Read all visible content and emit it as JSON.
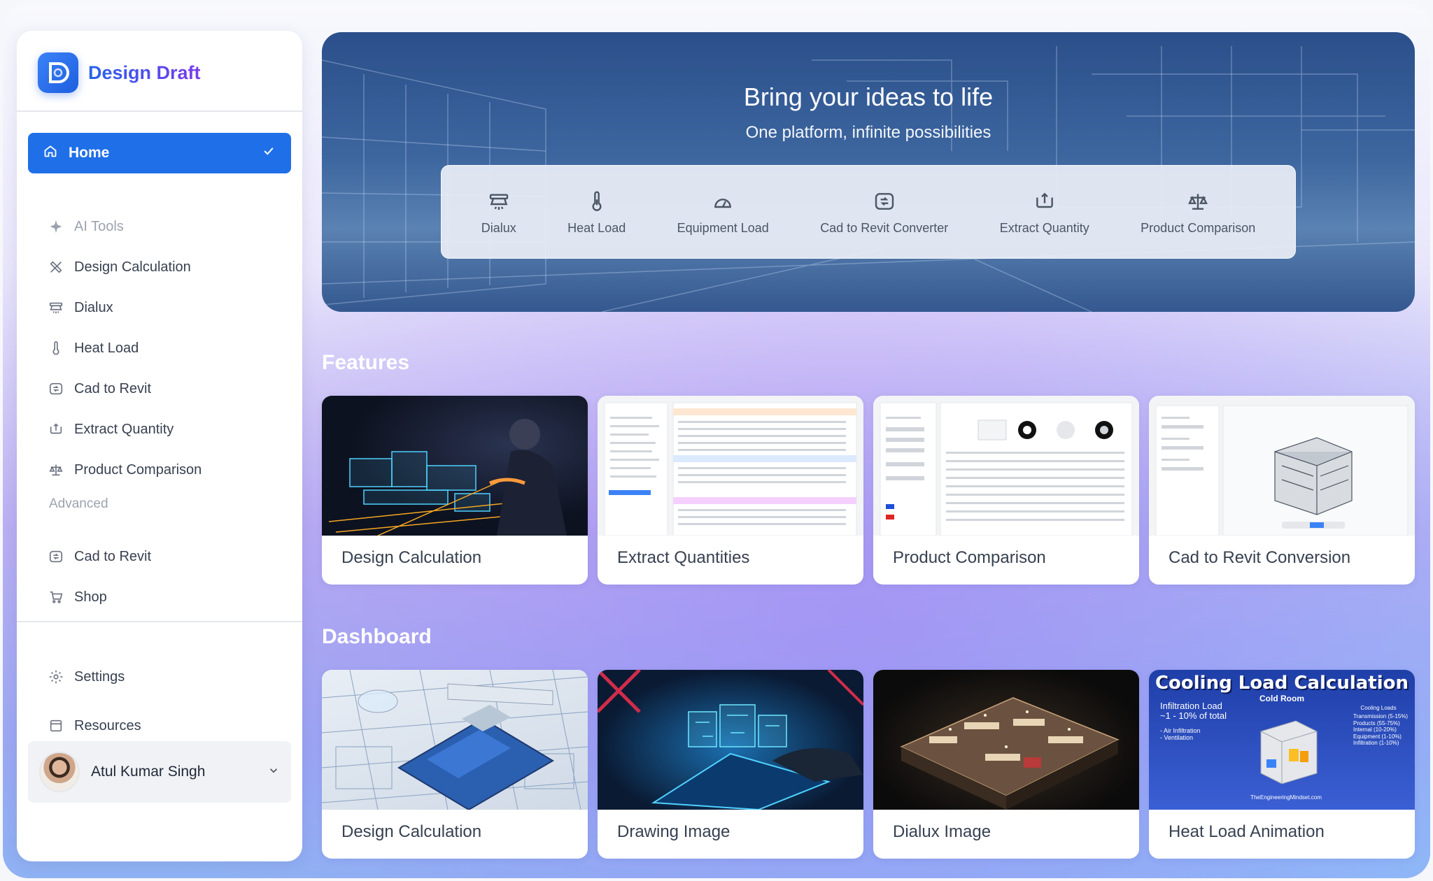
{
  "brand": {
    "name": "Design Draft",
    "logo_letter": "D"
  },
  "sidebar": {
    "home_label": "Home",
    "main_items": [
      {
        "label": "AI Tools",
        "icon": "sparkle-icon"
      },
      {
        "label": "Design Calculation",
        "icon": "ruler-pencil-icon"
      },
      {
        "label": "Dialux",
        "icon": "light-fixture-icon"
      },
      {
        "label": "Heat Load",
        "icon": "thermometer-icon"
      },
      {
        "label": "Cad to Revit",
        "icon": "convert-icon"
      },
      {
        "label": "Extract Quantity",
        "icon": "extract-icon"
      },
      {
        "label": "Product Comparison",
        "icon": "scale-icon"
      }
    ],
    "advanced_label": "Advanced",
    "advanced_items": [
      {
        "label": "Cad to Revit",
        "icon": "convert-icon"
      },
      {
        "label": "Shop",
        "icon": "cart-icon"
      }
    ],
    "bottom_items": [
      {
        "label": "Settings",
        "icon": "gear-icon"
      },
      {
        "label": "Resources",
        "icon": "folder-icon"
      }
    ],
    "user": {
      "name": "Atul Kumar Singh"
    }
  },
  "hero": {
    "title": "Bring your ideas to life",
    "subtitle": "One platform, infinite possibilities",
    "tools": [
      {
        "label": "Dialux",
        "icon": "light-fixture-icon"
      },
      {
        "label": "Heat Load",
        "icon": "thermometer-icon"
      },
      {
        "label": "Equipment Load",
        "icon": "gauge-icon"
      },
      {
        "label": "Cad to Revit Converter",
        "icon": "convert-icon"
      },
      {
        "label": "Extract Quantity",
        "icon": "extract-icon"
      },
      {
        "label": "Product Comparison",
        "icon": "scale-icon"
      }
    ]
  },
  "features": {
    "title": "Features",
    "cards": [
      {
        "label": "Design Calculation"
      },
      {
        "label": "Extract Quantities"
      },
      {
        "label": "Product Comparison"
      },
      {
        "label": "Cad to Revit Conversion"
      }
    ]
  },
  "dashboard": {
    "title": "Dashboard",
    "cards": [
      {
        "label": "Design Calculation"
      },
      {
        "label": "Drawing Image"
      },
      {
        "label": "Dialux Image"
      },
      {
        "label": "Heat Load Animation"
      }
    ],
    "cooling_thumb": {
      "title": "Cooling Load Calculation",
      "subtitle": "Cold Room",
      "left_text": "Infiltration Load",
      "left_sub": "~1 - 10% of total",
      "bullets": "- Air Infiltration\n- Ventilation",
      "right_title": "Cooling Loads",
      "right_lines": "Transmission (5-15%)\nProducts (55-75%)\nInternal (10-20%)\nEquipment (1-10%)\nInfiltration (1-10%)",
      "footer": "TheEngineeringMindset.com"
    }
  },
  "colors": {
    "primary": "#1f6fe8",
    "brand_gradient_end": "#7c3aed"
  }
}
